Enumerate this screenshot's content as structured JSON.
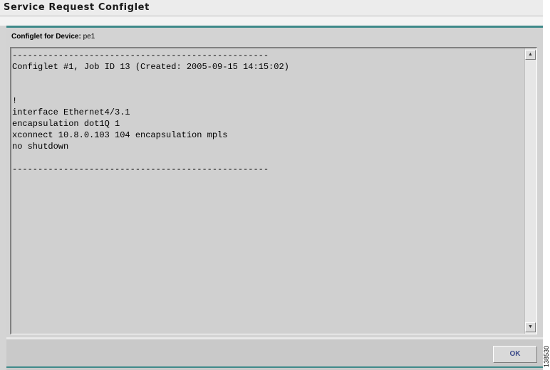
{
  "window": {
    "title": "Service Request Configlet"
  },
  "panel": {
    "label_prefix": "Configlet for Device:",
    "device_name": "pe1"
  },
  "configlet": {
    "text": "--------------------------------------------------\nConfiglet #1, Job ID 13 (Created: 2005-09-15 14:15:02)\n\n\n!\ninterface Ethernet4/3.1\nencapsulation dot1Q 1\nxconnect 10.8.0.103 104 encapsulation mpls\nno shutdown\n\n--------------------------------------------------"
  },
  "scrollbar": {
    "up_icon": "scroll-up-arrow",
    "down_icon": "scroll-down-arrow"
  },
  "footer": {
    "ok_label": "OK"
  },
  "figure_number": "138530",
  "colors": {
    "accent": "#3f8a8a",
    "ok_text": "#3b4a8a",
    "panel_bg": "#d3d3d3"
  }
}
